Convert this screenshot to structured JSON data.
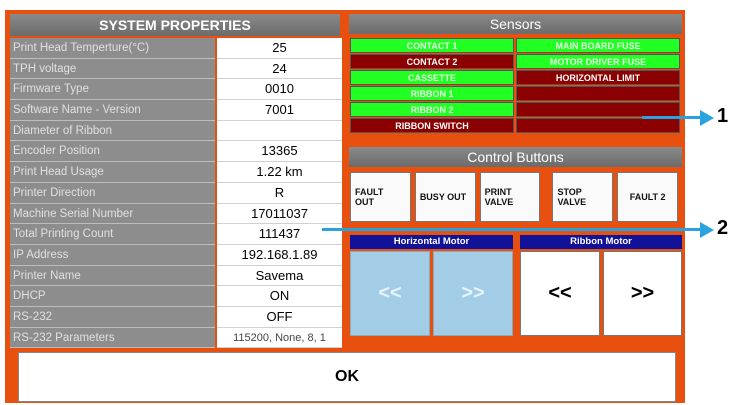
{
  "system_properties": {
    "title": "SYSTEM PROPERTIES",
    "rows": [
      {
        "label": "Print Head Temperture(°C)",
        "value": "25"
      },
      {
        "label": "TPH voltage",
        "value": "24"
      },
      {
        "label": "Firmware Type",
        "value": "0010"
      },
      {
        "label": "Software Name - Version",
        "value": "7001"
      },
      {
        "label": "Diameter of Ribbon",
        "value": ""
      },
      {
        "label": "Encoder Position",
        "value": "13365"
      },
      {
        "label": "Print Head Usage",
        "value": "1.22 km"
      },
      {
        "label": "Printer Direction",
        "value": "R"
      },
      {
        "label": "Machine Serial Number",
        "value": "17011037"
      },
      {
        "label": "Total Printing Count",
        "value": "111437"
      },
      {
        "label": "IP Address",
        "value": "192.168.1.89"
      },
      {
        "label": "Printer Name",
        "value": "Savema"
      },
      {
        "label": "DHCP",
        "value": "ON"
      },
      {
        "label": "RS-232",
        "value": "OFF"
      },
      {
        "label": "RS-232 Parameters",
        "value": "115200, None, 8, 1"
      }
    ]
  },
  "sensors": {
    "title": "Sensors",
    "rows": [
      [
        {
          "label": "CONTACT 1",
          "state": "on"
        },
        {
          "label": "MAIN BOARD FUSE",
          "state": "on"
        }
      ],
      [
        {
          "label": "CONTACT 2",
          "state": "off"
        },
        {
          "label": "MOTOR DRIVER FUSE",
          "state": "on"
        }
      ],
      [
        {
          "label": "CASSETTE",
          "state": "on"
        },
        {
          "label": "HORIZONTAL LIMIT",
          "state": "off"
        }
      ],
      [
        {
          "label": "RIBBON 1",
          "state": "on"
        },
        {
          "label": "",
          "state": "off"
        }
      ],
      [
        {
          "label": "RIBBON 2",
          "state": "on"
        },
        {
          "label": "",
          "state": "off"
        }
      ],
      [
        {
          "label": "RIBBON SWITCH",
          "state": "off"
        },
        {
          "label": "",
          "state": "off"
        }
      ]
    ]
  },
  "control_buttons": {
    "title": "Control Buttons",
    "buttons": [
      "FAULT\nOUT",
      "BUSY OUT",
      "PRINT\nVALVE",
      "STOP\nVALVE",
      "FAULT 2"
    ]
  },
  "horizontal_motor": {
    "title": "Horizontal Motor",
    "left": "<<",
    "right": ">>"
  },
  "ribbon_motor": {
    "title": "Ribbon Motor",
    "left": "<<",
    "right": ">>"
  },
  "ok_label": "OK",
  "callouts": [
    "1",
    "2"
  ]
}
